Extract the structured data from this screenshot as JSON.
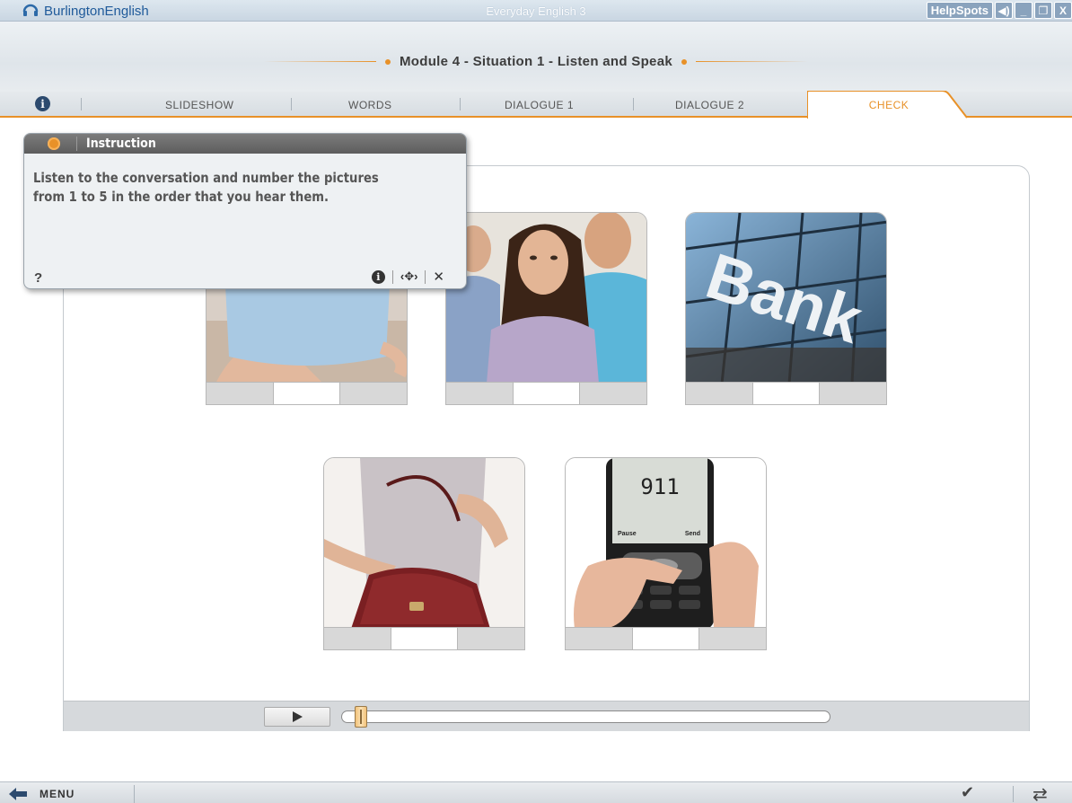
{
  "window": {
    "brand_name": "BurlingtonEnglish",
    "app_title": "Everyday English 3",
    "helpspots_label": "HelpSpots",
    "controls": {
      "sound": "◀)",
      "minimize": "_",
      "restore": "❐",
      "close": "X"
    }
  },
  "module": {
    "title": "Module 4 - Situation 1 - Listen and Speak"
  },
  "tabs": {
    "info_icon": "i",
    "items": [
      {
        "label": "SLIDESHOW"
      },
      {
        "label": "WORDS"
      },
      {
        "label": "DIALOGUE 1"
      },
      {
        "label": "DIALOGUE 2"
      },
      {
        "label": "CHECK",
        "active": true
      }
    ]
  },
  "instruction": {
    "header": "Instruction",
    "text": "Listen to the conversation and number the pictures from 1 to 5 in the order that you hear them.",
    "help_label": "?",
    "info_icon": "i",
    "move_icon": "‹✥›",
    "close_icon": "✕"
  },
  "pictures": [
    {
      "name": "cup-of-tea",
      "number": ""
    },
    {
      "name": "woman-in-crowd",
      "number": ""
    },
    {
      "name": "bank-building",
      "number": "",
      "sign_text": "Bank"
    },
    {
      "name": "woman-with-handbag",
      "number": ""
    },
    {
      "name": "phone-dialing-911",
      "number": "",
      "screen_text": "911",
      "soft_left": "Pause",
      "soft_right": "Send"
    }
  ],
  "player": {
    "progress": 0.02
  },
  "bottom": {
    "menu_label": "MENU",
    "check_icon": "✔",
    "refresh_icon": "⇄"
  },
  "colors": {
    "accent": "#e89128",
    "header_gray": "#6a6a6a",
    "brand_blue": "#1f5a9a"
  }
}
